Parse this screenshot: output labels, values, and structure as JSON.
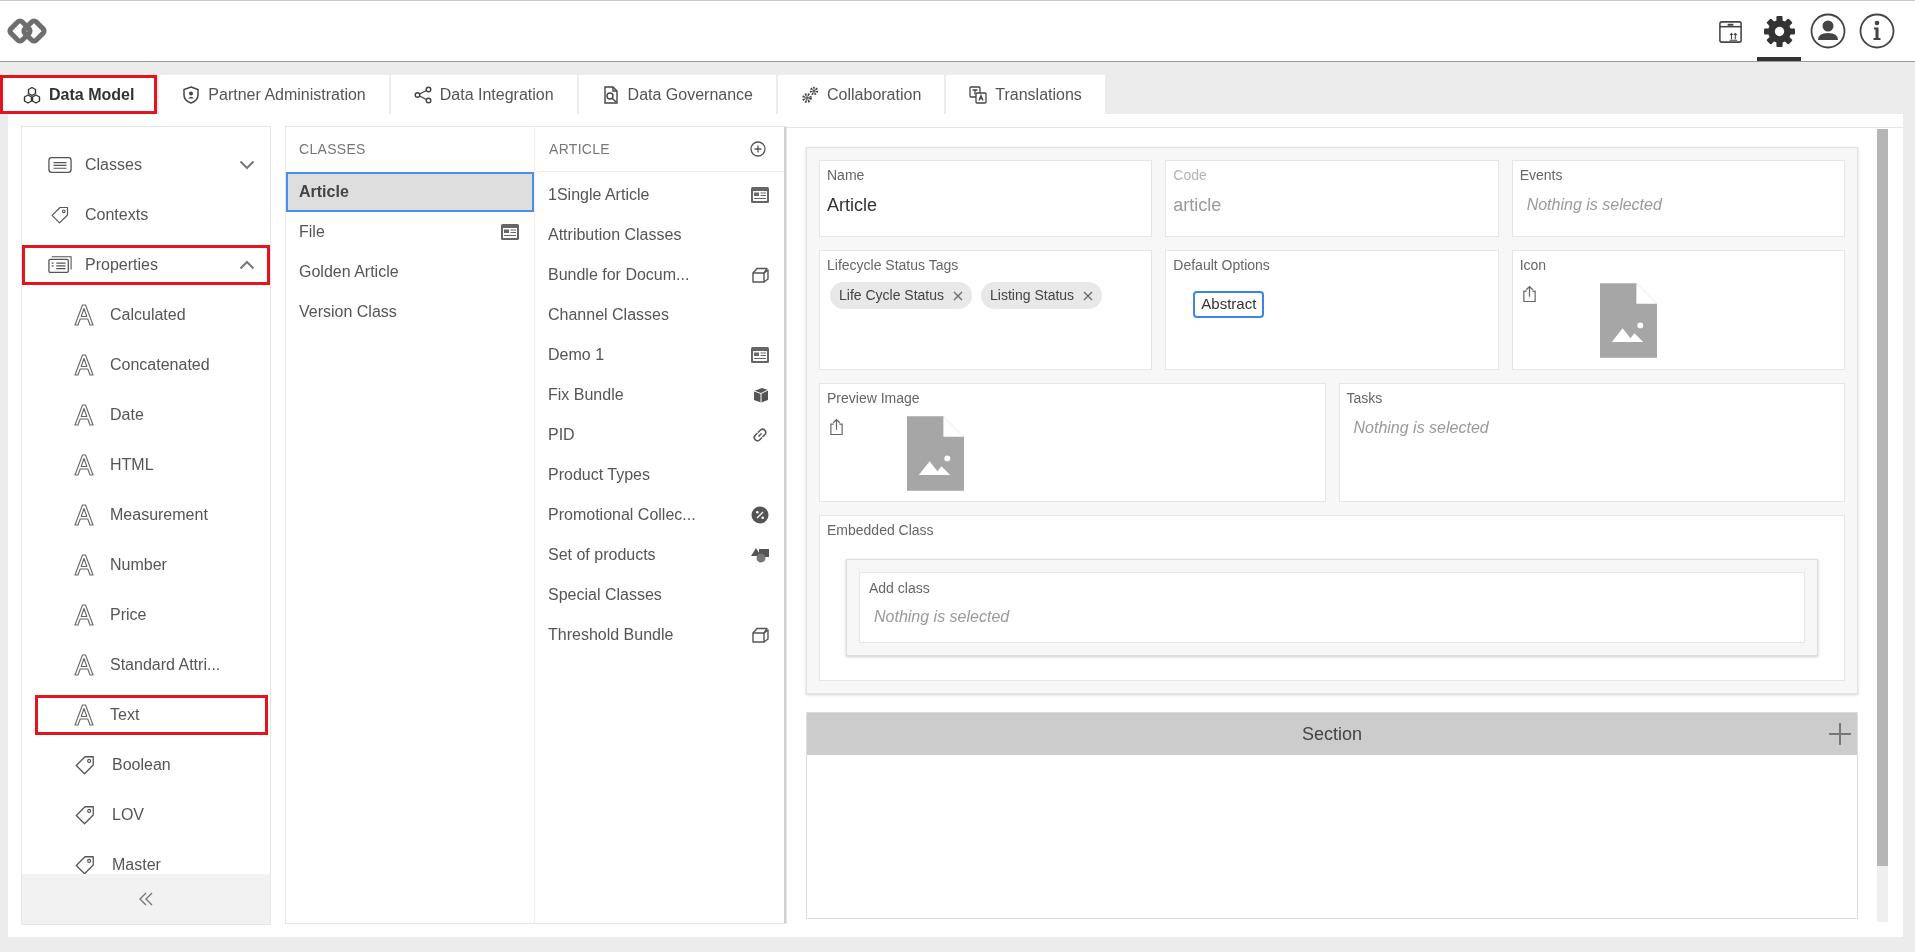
{
  "header": {
    "toolbar": [
      {
        "selected": false
      },
      {
        "selected": true
      },
      {
        "selected": false
      },
      {
        "selected": false
      }
    ]
  },
  "tabs": [
    {
      "label": "Data Model",
      "selected": true,
      "highlighted": true
    },
    {
      "label": "Partner Administration",
      "selected": false,
      "highlighted": false
    },
    {
      "label": "Data Integration",
      "selected": false,
      "highlighted": false
    },
    {
      "label": "Data Governance",
      "selected": false,
      "highlighted": false
    },
    {
      "label": "Collaboration",
      "selected": false,
      "highlighted": false
    },
    {
      "label": "Translations",
      "selected": false,
      "highlighted": false
    }
  ],
  "sidebar": {
    "items": [
      {
        "label": "Classes",
        "expanded": false,
        "highlighted": false
      },
      {
        "label": "Contexts",
        "highlighted": false
      },
      {
        "label": "Properties",
        "expanded": true,
        "highlighted": true,
        "children": [
          {
            "label": "Calculated",
            "kind": "text",
            "highlighted": false
          },
          {
            "label": "Concatenated",
            "kind": "text",
            "highlighted": false
          },
          {
            "label": "Date",
            "kind": "text",
            "highlighted": false
          },
          {
            "label": "HTML",
            "kind": "text",
            "highlighted": false
          },
          {
            "label": "Measurement",
            "kind": "text",
            "highlighted": false
          },
          {
            "label": "Number",
            "kind": "text",
            "highlighted": false
          },
          {
            "label": "Price",
            "kind": "text",
            "highlighted": false
          },
          {
            "label": "Standard Attri...",
            "kind": "text",
            "highlighted": false
          },
          {
            "label": "Text",
            "kind": "text",
            "highlighted": true
          },
          {
            "label": "Boolean",
            "kind": "tag",
            "highlighted": false
          },
          {
            "label": "LOV",
            "kind": "tag",
            "highlighted": false
          },
          {
            "label": "Master",
            "kind": "tag",
            "highlighted": false
          }
        ]
      }
    ]
  },
  "classes": {
    "title": "CLASSES",
    "items": [
      {
        "label": "Article",
        "kind": "plain",
        "selected": true
      },
      {
        "label": "File",
        "kind": "form",
        "selected": false
      },
      {
        "label": "Golden Article",
        "kind": "plain",
        "selected": false
      },
      {
        "label": "Version Class",
        "kind": "plain",
        "selected": false
      }
    ]
  },
  "article": {
    "title": "ARTICLE",
    "items": [
      {
        "label": "1Single Article",
        "kind": "form",
        "selected": false
      },
      {
        "label": "Attribution Classes",
        "kind": "plain",
        "selected": false
      },
      {
        "label": "Bundle for Docum...",
        "kind": "bundle",
        "selected": false
      },
      {
        "label": "Channel Classes",
        "kind": "plain",
        "selected": false
      },
      {
        "label": "Demo 1",
        "kind": "form",
        "selected": false
      },
      {
        "label": "Fix Bundle",
        "kind": "box",
        "selected": false
      },
      {
        "label": "PID",
        "kind": "link",
        "selected": false
      },
      {
        "label": "Product Types",
        "kind": "plain",
        "selected": false
      },
      {
        "label": "Promotional Collec...",
        "kind": "promo",
        "selected": false
      },
      {
        "label": "Set of products",
        "kind": "set",
        "selected": false
      },
      {
        "label": "Special Classes",
        "kind": "plain",
        "selected": false
      },
      {
        "label": "Threshold Bundle",
        "kind": "bundle",
        "selected": false
      }
    ]
  },
  "form": {
    "rows": [
      [
        {
          "kind": "text",
          "label": "Name",
          "value": "Article",
          "disabled": false
        },
        {
          "kind": "text",
          "label": "Code",
          "value": "article",
          "disabled": true
        },
        {
          "kind": "select",
          "label": "Events",
          "placeholder": "Nothing is selected"
        }
      ],
      [
        {
          "kind": "tags",
          "label": "Lifecycle Status Tags",
          "tags": [
            "Life Cycle Status",
            "Listing Status"
          ]
        },
        {
          "kind": "options",
          "label": "Default Options",
          "options": [
            {
              "label": "Abstract",
              "selected": true
            }
          ]
        },
        {
          "kind": "image",
          "label": "Icon"
        }
      ],
      [
        {
          "kind": "image",
          "label": "Preview Image"
        },
        {
          "kind": "select",
          "label": "Tasks",
          "placeholder": "Nothing is selected"
        }
      ],
      [
        {
          "kind": "embedded",
          "label": "Embedded Class",
          "field": {
            "label": "Add class",
            "placeholder": "Nothing is selected"
          }
        }
      ]
    ]
  },
  "section": {
    "title": "Section"
  }
}
